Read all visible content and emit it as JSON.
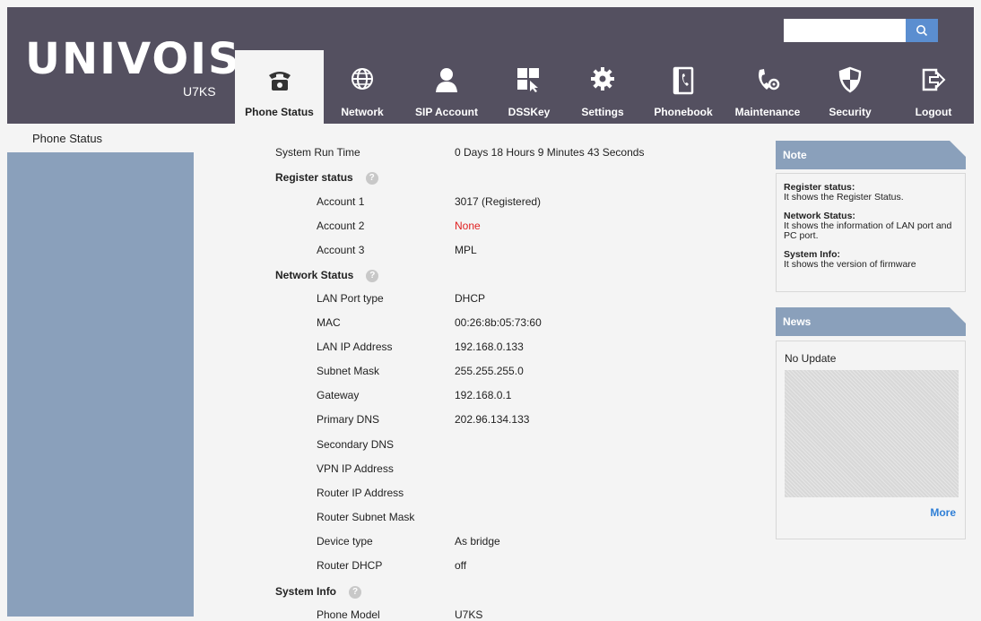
{
  "header": {
    "logo": "UNIVOIS",
    "model": "U7KS",
    "search": {
      "value": "",
      "placeholder": ""
    },
    "nav": [
      {
        "label": "Phone Status",
        "icon": "phone-icon",
        "active": true
      },
      {
        "label": "Network",
        "icon": "globe-icon"
      },
      {
        "label": "SIP Account",
        "icon": "user-icon"
      },
      {
        "label": "DSSKey",
        "icon": "dsskey-icon"
      },
      {
        "label": "Settings",
        "icon": "gear-icon"
      },
      {
        "label": "Phonebook",
        "icon": "phonebook-icon"
      },
      {
        "label": "Maintenance",
        "icon": "maintenance-icon"
      },
      {
        "label": "Security",
        "icon": "shield-icon"
      },
      {
        "label": "Logout",
        "icon": "logout-icon"
      }
    ]
  },
  "sidebar": {
    "title": "Phone Status"
  },
  "status": {
    "system_run_time": {
      "label": "System Run Time",
      "value": "0 Days 18 Hours 9 Minutes 43 Seconds"
    },
    "register_section": "Register status",
    "accounts": [
      {
        "label": "Account 1",
        "value": "3017 (Registered)"
      },
      {
        "label": "Account 2",
        "value": "None"
      },
      {
        "label": "Account 3",
        "value": "MPL"
      }
    ],
    "network_section": "Network Status",
    "network": [
      {
        "label": "LAN Port type",
        "value": "DHCP"
      },
      {
        "label": "MAC",
        "value": "00:26:8b:05:73:60"
      },
      {
        "label": "LAN IP Address",
        "value": "192.168.0.133"
      },
      {
        "label": "Subnet Mask",
        "value": "255.255.255.0"
      },
      {
        "label": "Gateway",
        "value": "192.168.0.1"
      },
      {
        "label": "Primary DNS",
        "value": "202.96.134.133"
      },
      {
        "label": "Secondary DNS",
        "value": ""
      },
      {
        "label": "VPN IP Address",
        "value": ""
      },
      {
        "label": "Router IP Address",
        "value": ""
      },
      {
        "label": "Router Subnet Mask",
        "value": ""
      },
      {
        "label": "Device type",
        "value": "As bridge"
      },
      {
        "label": "Router DHCP",
        "value": "off"
      }
    ],
    "system_section": "System Info",
    "system": [
      {
        "label": "Phone Model",
        "value": "U7KS"
      }
    ]
  },
  "note": {
    "title": "Note",
    "items": [
      {
        "heading": "Register status:",
        "text": "It shows the Register Status."
      },
      {
        "heading": "Network Status:",
        "text": "It shows the information of LAN port and PC port."
      },
      {
        "heading": "System Info:",
        "text": "It shows the version of firmware"
      }
    ]
  },
  "news": {
    "title": "News",
    "text": "No Update",
    "more": "More"
  },
  "colors": {
    "header_bg": "#545060",
    "sidebar_bg": "#8aa0bb",
    "accent_blue": "#5b8ed0",
    "error_red": "#e02020",
    "link_blue": "#2f7fd6"
  }
}
